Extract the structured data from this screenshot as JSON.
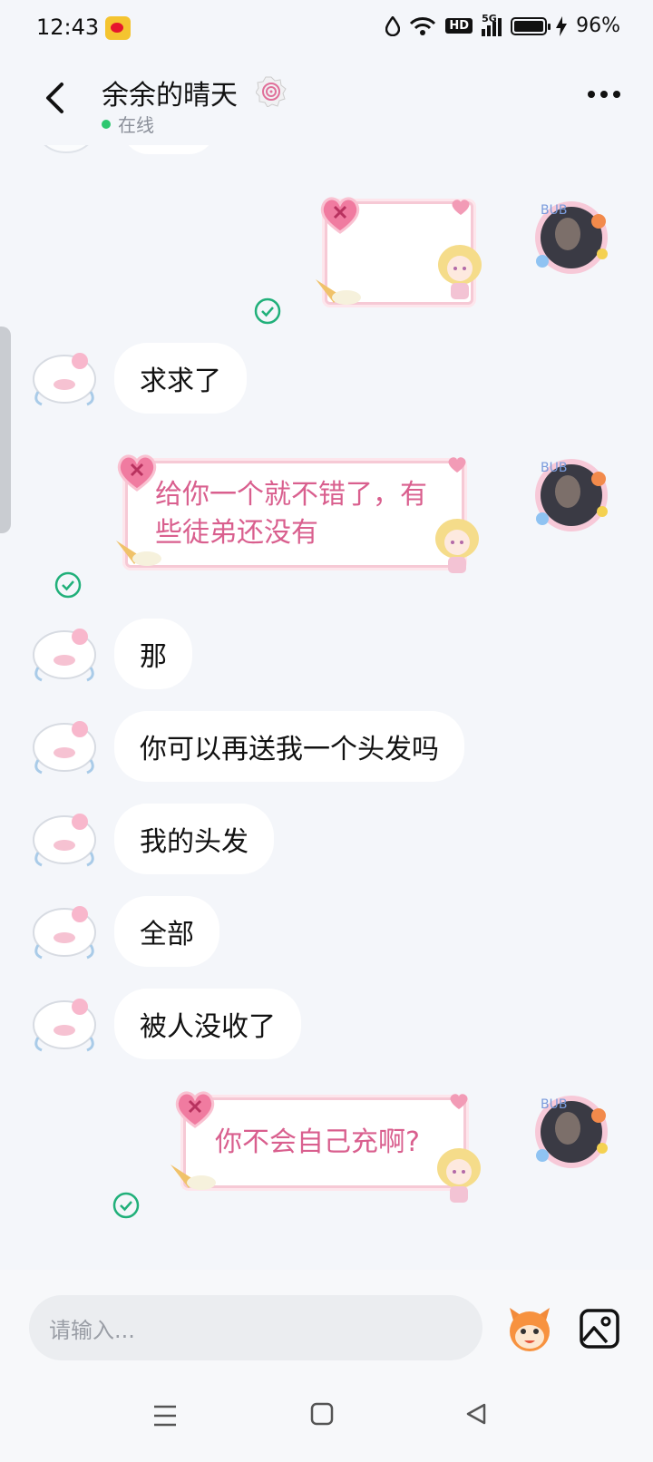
{
  "status_bar": {
    "time": "12:43",
    "network": "5G",
    "hd": "HD",
    "battery_percent": "96%"
  },
  "header": {
    "contact_name": "余余的晴天",
    "status": "在线"
  },
  "messages": [
    {
      "side": "right",
      "type": "sticker-card",
      "text": ""
    },
    {
      "side": "left",
      "text": "求求了"
    },
    {
      "side": "right",
      "type": "sticker-card",
      "text": "给你一个就不错了，有些徒弟还没有"
    },
    {
      "side": "left",
      "text": "那"
    },
    {
      "side": "left",
      "text": "你可以再送我一个头发吗"
    },
    {
      "side": "left",
      "text": "我的头发"
    },
    {
      "side": "left",
      "text": "全部"
    },
    {
      "side": "left",
      "text": "被人没收了"
    },
    {
      "side": "right",
      "type": "sticker-card",
      "text": "你不会自己充啊?"
    }
  ],
  "input": {
    "placeholder": "请输入..."
  },
  "colors": {
    "background": "#f4f6fa",
    "bubble": "#ffffff",
    "sticker_text": "#d95f8e",
    "sticker_border": "#f6c9d5",
    "check": "#21b07a",
    "online": "#2ec770"
  },
  "icons": [
    "back-icon",
    "badge-icon",
    "more-icon",
    "check-icon",
    "emoji-icon",
    "image-icon",
    "menu-icon",
    "home-icon",
    "back-triangle-icon"
  ]
}
